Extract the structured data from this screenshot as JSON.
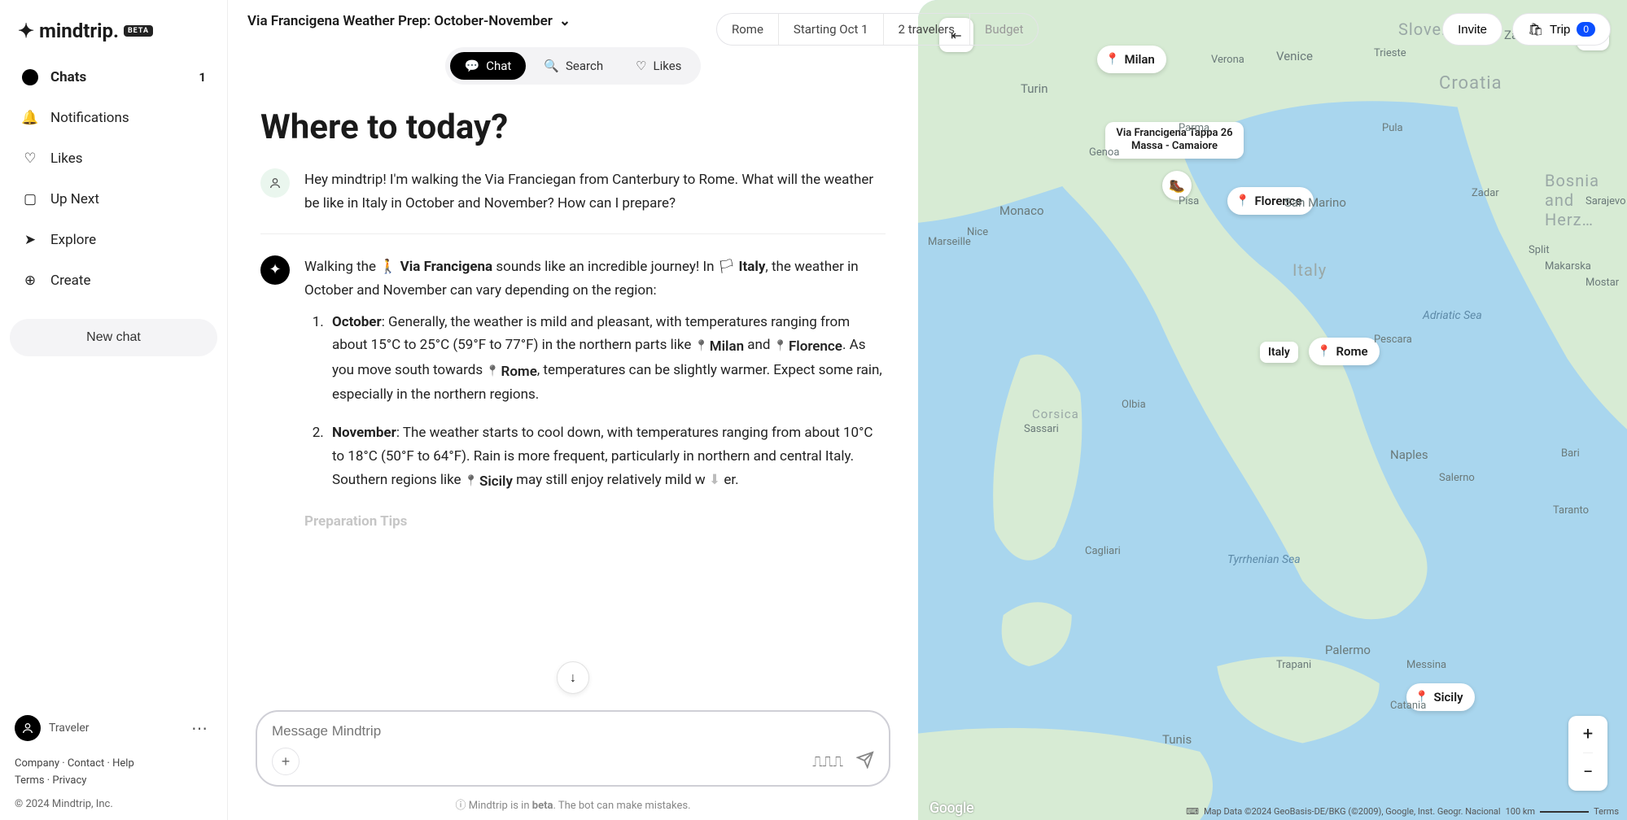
{
  "brand": {
    "name": "mindtrip.",
    "beta_badge": "BETA"
  },
  "sidebar": {
    "items": [
      {
        "label": "Chats",
        "badge": "1"
      },
      {
        "label": "Notifications"
      },
      {
        "label": "Likes"
      },
      {
        "label": "Up Next"
      },
      {
        "label": "Explore"
      },
      {
        "label": "Create"
      }
    ],
    "new_chat": "New chat",
    "user": "Traveler",
    "footer": {
      "company": "Company",
      "contact": "Contact",
      "help": "Help",
      "terms": "Terms",
      "privacy": "Privacy",
      "copyright": "© 2024 Mindtrip, Inc."
    }
  },
  "header": {
    "trip_title": "Via Francigena Weather Prep: October-November",
    "pills": [
      "Rome",
      "Starting Oct 1",
      "2 travelers",
      "Budget"
    ],
    "invite": "Invite",
    "trip_label": "Trip",
    "trip_count": "0"
  },
  "tabs": {
    "chat": "Chat",
    "search": "Search",
    "likes": "Likes"
  },
  "chat": {
    "headline": "Where to today?",
    "user_msg": "Hey mindtrip! I'm walking the Via Franciegan from Canterbury to Rome. What will the weather be like in Italy in October and November? How can I prepare?",
    "bot_intro_pre": "Walking the ",
    "via": "Via Francigena",
    "bot_intro_mid": " sounds like an incredible journey! In ",
    "italy": "Italy",
    "bot_intro_post": ", the weather in October and November can vary depending on the region:",
    "oct_head": "October",
    "oct_a": ": Generally, the weather is mild and pleasant, with temperatures ranging from about 15°C to 25°C (59°F to 77°F) in the northern parts like ",
    "milan": "Milan",
    "and": " and ",
    "florence": "Florence",
    "oct_b": ". As you move south towards ",
    "rome": "Rome",
    "oct_c": ", temperatures can be slightly warmer. Expect some rain, especially in the northern regions.",
    "nov_head": "November",
    "nov_a": ": The weather starts to cool down, with temperatures ranging from about 10°C to 18°C (50°F to 64°F). Rain is more frequent, particularly in northern and central Italy. Southern regions like ",
    "sicily": "Sicily",
    "nov_b": " may still enjoy relatively mild w",
    "nov_cut": "er.",
    "prep": "Preparation Tips"
  },
  "composer": {
    "placeholder": "Message Mindtrip"
  },
  "beta_note": {
    "pre": "Mindtrip is in ",
    "strong": "beta",
    "post": ". The bot can make mistakes."
  },
  "map": {
    "markers": {
      "milan": "Milan",
      "florence": "Florence",
      "rome": "Rome",
      "sicily": "Sicily",
      "italy": "Italy"
    },
    "pinbox": "Via Francigena Tappa 26 Massa - Camaiore",
    "cities": {
      "turin": "Turin",
      "genoa": "Genoa",
      "monaco": "Monaco",
      "nice": "Nice",
      "verona": "Verona",
      "venice": "Venice",
      "trieste": "Trieste",
      "zagreb": "Zagreb",
      "zadar": "Zadar",
      "split": "Split",
      "sarajevo": "Sarajevo",
      "mostar": "Mostar",
      "pescara": "Pescara",
      "naples": "Naples",
      "salerno": "Salerno",
      "bari": "Bari",
      "taranto": "Taranto",
      "palermo": "Palermo",
      "catania": "Catania",
      "messina": "Messina",
      "trapani": "Trapani",
      "olbia": "Olbia",
      "cagliari": "Cagliari",
      "tunis": "Tunis",
      "sanmarino": "San Marino",
      "pula": "Pula",
      "parma": "Parma",
      "pisa": "Pisa",
      "marseille": "Marseille",
      "sassari": "Sassari",
      "makarska": "Makarska"
    },
    "regions": {
      "slovenia": "Slovenia",
      "croatia": "Croatia",
      "bosnia": "Bosnia and Herz…",
      "italy": "Italy",
      "corsica": "Corsica"
    },
    "seas": {
      "adriatic": "Adriatic Sea",
      "tyrr": "Tyrrhenian Sea"
    },
    "attrib": {
      "mapdata": "Map Data ©2024 GeoBasis-DE/BKG (©2009), Google, Inst. Geogr. Nacional",
      "scale": "100 km",
      "terms": "Terms"
    },
    "google": "Google"
  }
}
